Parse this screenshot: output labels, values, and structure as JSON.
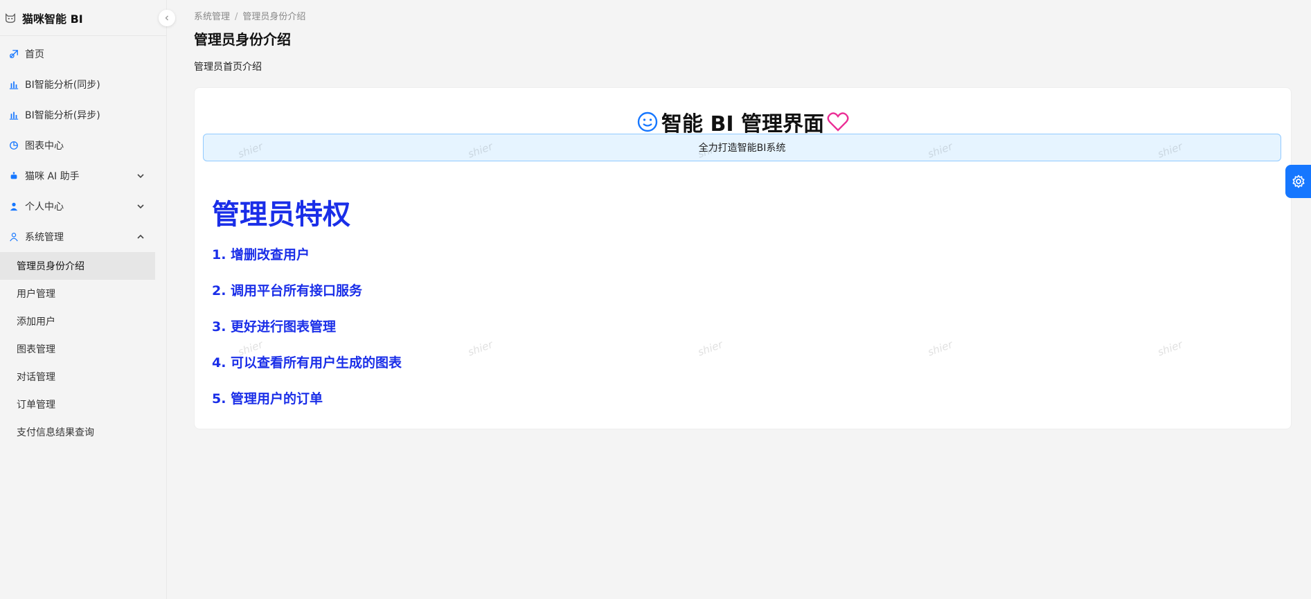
{
  "app": {
    "title": "猫咪智能 BI"
  },
  "colors": {
    "accent": "#1677ff",
    "privilege_blue": "#1a2ee8",
    "heart_pink": "#eb2f96"
  },
  "sidebar": {
    "items": [
      {
        "label": "首页",
        "icon": "home-icon"
      },
      {
        "label": "BI智能分析(同步)",
        "icon": "bar-chart-icon"
      },
      {
        "label": "BI智能分析(异步)",
        "icon": "bar-chart-icon"
      },
      {
        "label": "图表中心",
        "icon": "pie-chart-icon"
      },
      {
        "label": "猫咪 AI 助手",
        "icon": "robot-icon",
        "expanded": false
      },
      {
        "label": "个人中心",
        "icon": "user-icon",
        "expanded": false
      },
      {
        "label": "系统管理",
        "icon": "user-outline-icon",
        "expanded": true
      }
    ],
    "submenu": [
      {
        "label": "管理员身份介绍",
        "active": true
      },
      {
        "label": "用户管理"
      },
      {
        "label": "添加用户"
      },
      {
        "label": "图表管理"
      },
      {
        "label": "对话管理"
      },
      {
        "label": "订单管理"
      },
      {
        "label": "支付信息结果查询"
      }
    ]
  },
  "breadcrumb": [
    "系统管理",
    "/",
    "管理员身份介绍"
  ],
  "page": {
    "title": "管理员身份介绍",
    "subtitle": "管理员首页介绍"
  },
  "card": {
    "heading": "智能 BI 管理界面",
    "banner": "全力打造智能BI系统",
    "privilege_title": "管理员特权",
    "privileges": [
      "1. 增删改查用户",
      "2. 调用平台所有接口服务",
      "3. 更好进行图表管理",
      "4. 可以查看所有用户生成的图表",
      "5. 管理用户的订单"
    ]
  },
  "watermark": "shier"
}
